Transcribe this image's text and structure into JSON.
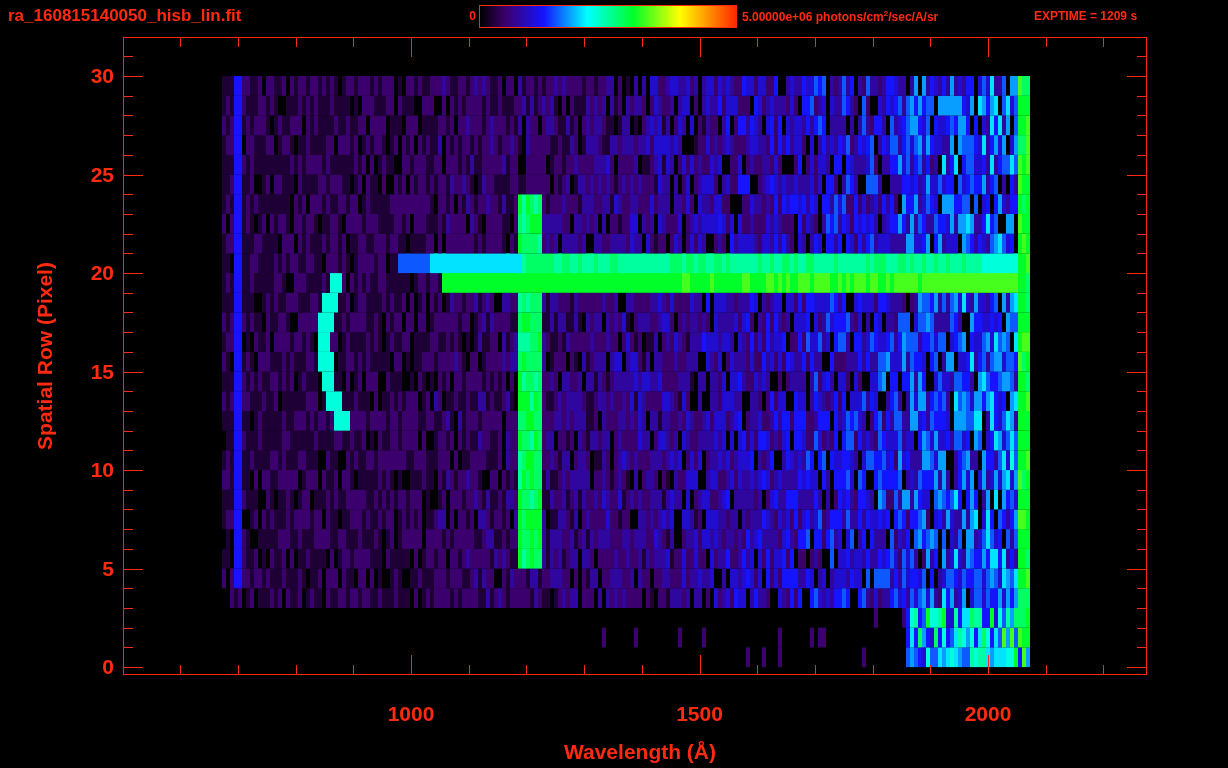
{
  "title": "ra_160815140050_hisb_lin.fit",
  "colorbar": {
    "min_label": "0",
    "max_label": "5.00000e+06 photons/cm$^{2}$/sec/A/sr"
  },
  "exposure": "EXPTIME = 1209 s",
  "y_axis": {
    "label": "Spatial Row (Pixel)",
    "ticks": [
      "30",
      "25",
      "20",
      "15",
      "10",
      "5",
      "0"
    ]
  },
  "x_axis": {
    "label": "Wavelength (Å)",
    "ticks": [
      "1000",
      "1500",
      "2000"
    ]
  }
}
